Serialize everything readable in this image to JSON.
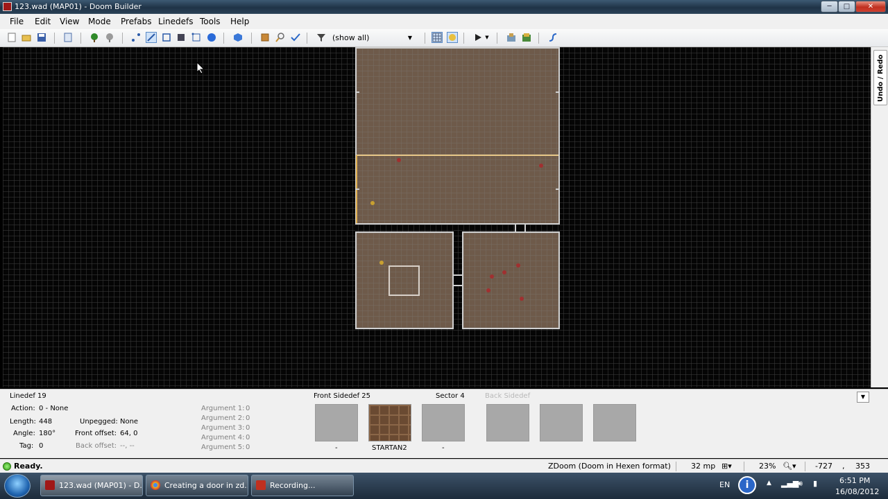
{
  "window": {
    "title": "123.wad (MAP01) - Doom Builder",
    "controls": {
      "min": "─",
      "max": "□",
      "close": "✕"
    }
  },
  "menu": [
    "File",
    "Edit",
    "View",
    "Mode",
    "Prefabs",
    "Linedefs",
    "Tools",
    "Help"
  ],
  "toolbar": {
    "filter_value": "(show all)",
    "icons": [
      "new-map-icon",
      "open-map-icon",
      "save-map-icon",
      "script-icon",
      "tree-icon",
      "gray-tree-icon",
      "vertices-mode-icon",
      "linedefs-mode-icon",
      "sectors-mode-icon",
      "things-mode-icon",
      "make-sectors-icon",
      "map-3d-icon",
      "visual-mode-icon",
      "prefab-icon",
      "find-icon",
      "check-map-icon",
      "filter-icon",
      "grid-icon",
      "texture-icon",
      "test-map-icon",
      "build-icon",
      "nodebuild-icon",
      "help-icon"
    ]
  },
  "side_panel": {
    "undo_redo_tab": "Undo / Redo"
  },
  "linedef_info": {
    "heading": "Linedef 19",
    "action_label": "Action:",
    "action_value": "0 - None",
    "length_label": "Length:",
    "length_value": "448",
    "angle_label": "Angle:",
    "angle_value": "180°",
    "tag_label": "Tag:",
    "tag_value": "0",
    "unpegged_label": "Unpegged:",
    "unpegged_value": "None",
    "front_offset_label": "Front offset:",
    "front_offset_value": "64, 0",
    "back_offset_label": "Back offset:",
    "back_offset_value": "--, --"
  },
  "arguments": [
    {
      "label": "Argument 1:",
      "value": "0"
    },
    {
      "label": "Argument 2:",
      "value": "0"
    },
    {
      "label": "Argument 3:",
      "value": "0"
    },
    {
      "label": "Argument 4:",
      "value": "0"
    },
    {
      "label": "Argument 5:",
      "value": "0"
    }
  ],
  "front_sidedef": {
    "heading": "Front Sidedef 25",
    "sector_heading": "Sector 4",
    "textures": [
      {
        "name": "-"
      },
      {
        "name": "STARTAN2"
      },
      {
        "name": "-"
      }
    ]
  },
  "back_sidedef": {
    "heading": "Back Sidedef"
  },
  "status": {
    "ready": "Ready.",
    "format": "ZDoom (Doom in Hexen format)",
    "grid": "32 mp",
    "zoom": "23%",
    "coord_x": "-727",
    "coord_sep": ",",
    "coord_y": "353"
  },
  "taskbar": {
    "tasks": [
      {
        "label": "123.wad (MAP01) - D...",
        "color": "#a01818"
      },
      {
        "label": "Creating a door in zd...",
        "color": "#e0b020"
      },
      {
        "label": "Recording...",
        "color": "#c03020"
      }
    ],
    "language": "EN",
    "time": "6:51 PM",
    "date": "16/08/2012"
  },
  "colors": {
    "map_background": "#050505",
    "sector_fill": "#6e5a4a",
    "linedef": "#d0d0d0",
    "selected_linedef": "#e8c888"
  }
}
